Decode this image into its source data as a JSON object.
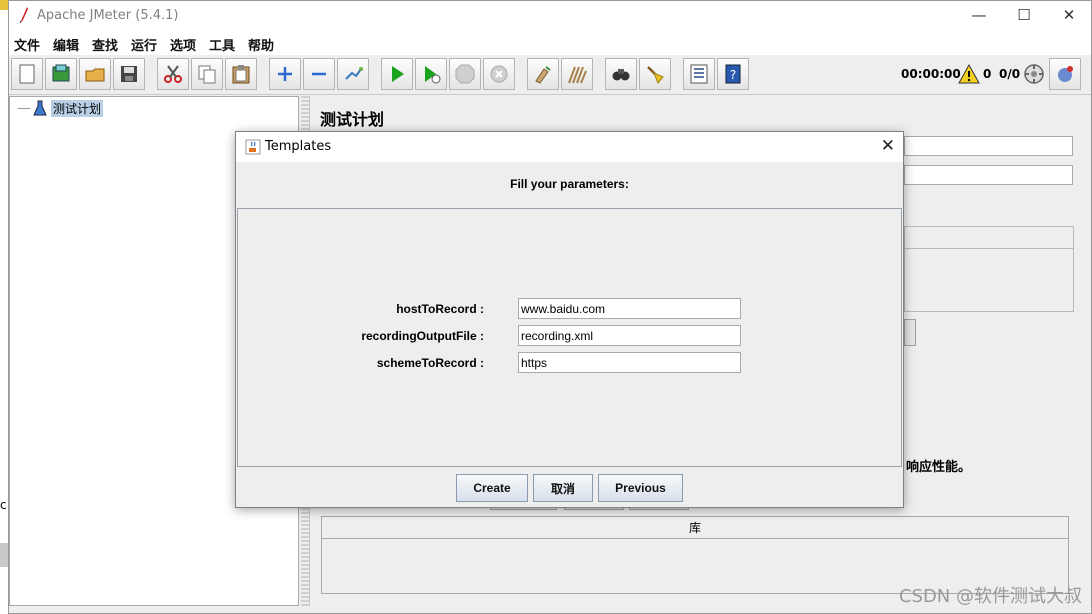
{
  "window": {
    "title": "Apache JMeter (5.4.1)",
    "controls": {
      "minimize": "—",
      "maximize": "☐",
      "close": "✕"
    }
  },
  "menu": [
    "文件",
    "编辑",
    "查找",
    "运行",
    "选项",
    "工具",
    "帮助"
  ],
  "toolbar": {
    "buttons": [
      {
        "name": "new-icon"
      },
      {
        "name": "templates-icon"
      },
      {
        "name": "open-icon"
      },
      {
        "name": "save-icon"
      },
      {
        "name": "cut-icon"
      },
      {
        "name": "copy-icon"
      },
      {
        "name": "paste-icon"
      },
      {
        "name": "expand-icon"
      },
      {
        "name": "collapse-icon"
      },
      {
        "name": "toggle-icon"
      },
      {
        "name": "start-icon"
      },
      {
        "name": "start-no-pause-icon"
      },
      {
        "name": "stop-icon"
      },
      {
        "name": "shutdown-icon"
      },
      {
        "name": "clear-icon"
      },
      {
        "name": "clear-all-icon"
      },
      {
        "name": "search-icon"
      },
      {
        "name": "reset-search-icon"
      },
      {
        "name": "function-helper-icon"
      },
      {
        "name": "help-icon"
      }
    ],
    "timer": "00:00:00",
    "warning_count": "0",
    "thread_count": "0/0"
  },
  "tree": {
    "root_label": "测试计划"
  },
  "right_panel": {
    "title": "测试计划",
    "partial_text": "响应性能。",
    "library_header": "库"
  },
  "dialog": {
    "title": "Templates",
    "heading": "Fill your parameters:",
    "params": [
      {
        "label": "hostToRecord :",
        "value": "www.baidu.com"
      },
      {
        "label": "recordingOutputFile :",
        "value": "recording.xml"
      },
      {
        "label": "schemeToRecord :",
        "value": "https"
      }
    ],
    "buttons": {
      "create": "Create",
      "cancel": "取消",
      "previous": "Previous"
    },
    "close": "✕"
  },
  "left_edge": {
    "glyph": "c:"
  },
  "watermark": "CSDN @软件测试大叔"
}
